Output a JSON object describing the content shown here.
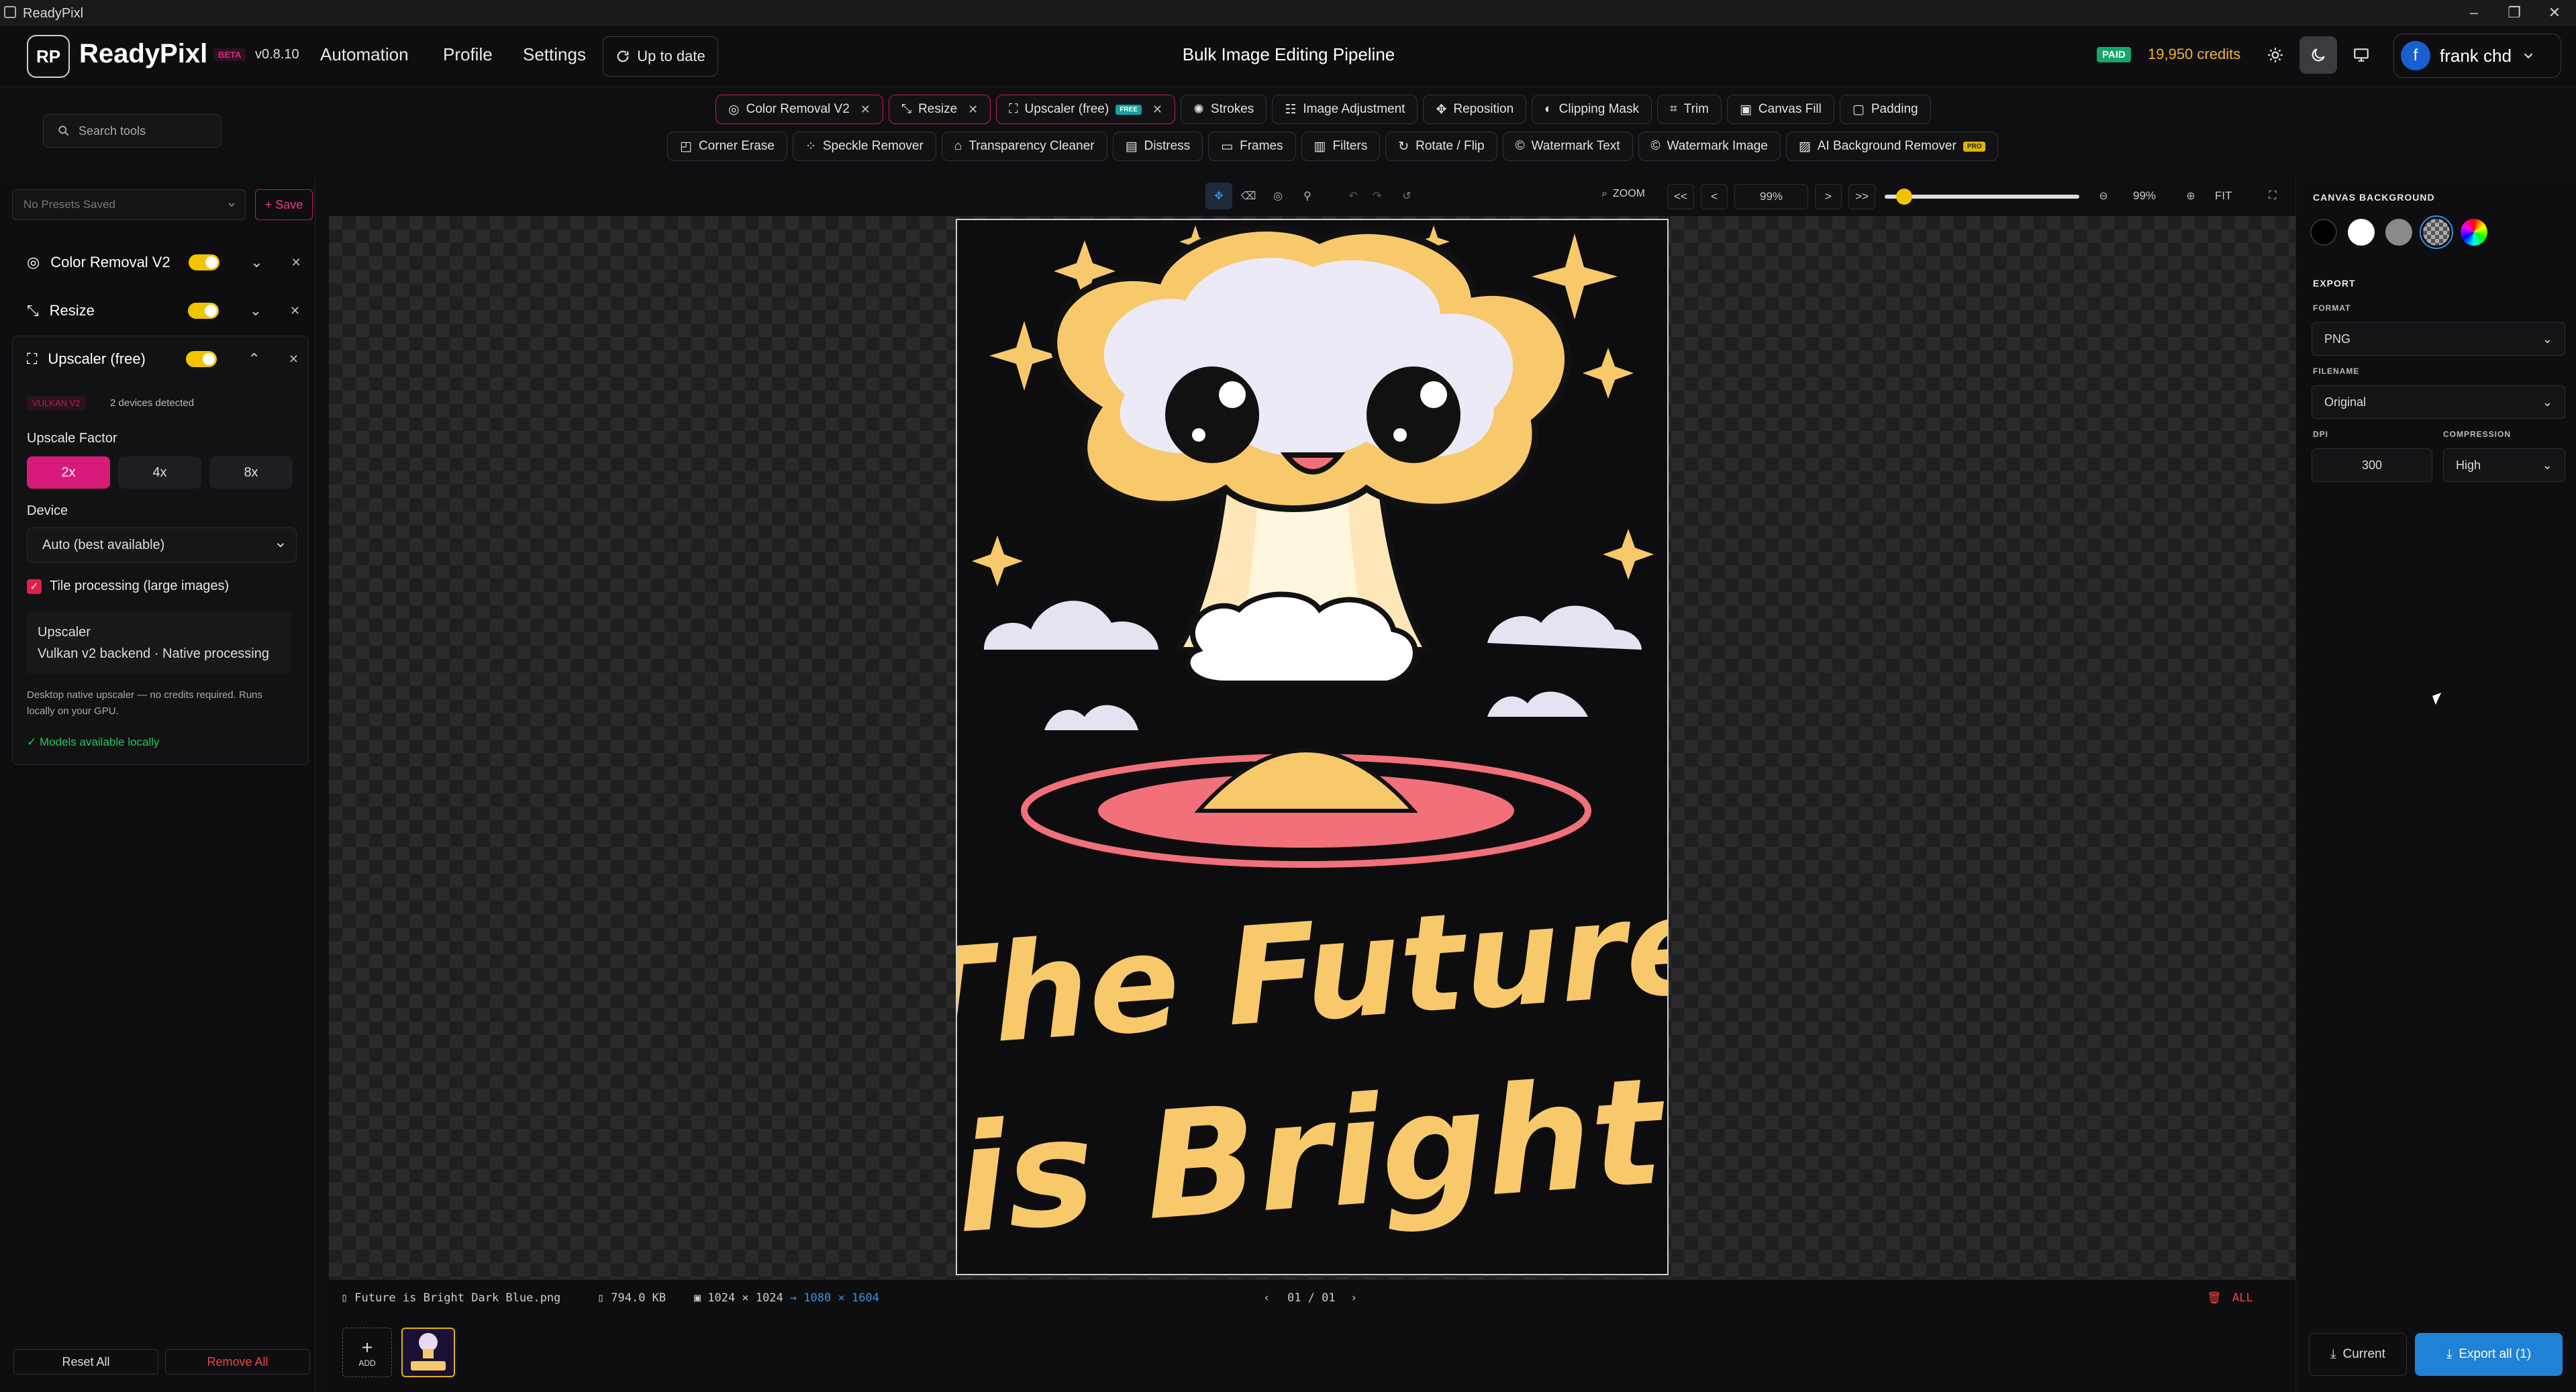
{
  "titlebar": {
    "app_name": "ReadyPixl"
  },
  "header": {
    "logo_text": "RP",
    "brand": "ReadyPixl",
    "beta": "BETA",
    "version": "v0.8.10",
    "nav": [
      "Automation",
      "Profile",
      "Settings"
    ],
    "up_to_date": "Up to date",
    "page_title": "Bulk Image Editing Pipeline",
    "plan_badge": "PAID",
    "credits": "19,950 credits",
    "user_initial": "f",
    "user_name": "frank chd"
  },
  "search": {
    "placeholder": "Search tools"
  },
  "tools_row1": [
    {
      "label": "Color Removal V2",
      "active": true
    },
    {
      "label": "Resize",
      "active": true
    },
    {
      "label": "Upscaler (free)",
      "active": true,
      "badge": "FREE"
    },
    {
      "label": "Strokes"
    },
    {
      "label": "Image Adjustment"
    },
    {
      "label": "Reposition"
    },
    {
      "label": "Clipping Mask"
    },
    {
      "label": "Trim"
    },
    {
      "label": "Canvas Fill"
    },
    {
      "label": "Padding"
    }
  ],
  "tools_row2": [
    {
      "label": "Corner Erase"
    },
    {
      "label": "Speckle Remover"
    },
    {
      "label": "Transparency Cleaner"
    },
    {
      "label": "Distress"
    },
    {
      "label": "Frames"
    },
    {
      "label": "Filters"
    },
    {
      "label": "Rotate / Flip"
    },
    {
      "label": "Watermark Text"
    },
    {
      "label": "Watermark Image"
    },
    {
      "label": "AI Background Remover",
      "badge": "PRO"
    }
  ],
  "presets": {
    "selected": "No Presets Saved",
    "save_label": "+ Save"
  },
  "pipeline": [
    {
      "name": "Color Removal V2",
      "enabled": true
    },
    {
      "name": "Resize",
      "enabled": true
    },
    {
      "name": "Upscaler (free)",
      "enabled": true
    }
  ],
  "upscaler": {
    "backend_badge": "VULKAN V2",
    "devices": "2 devices detected",
    "factor_label": "Upscale Factor",
    "factors": [
      "2x",
      "4x",
      "8x"
    ],
    "selected_factor": "2x",
    "device_label": "Device",
    "device_value": "Auto (best available)",
    "tile_label": "Tile processing (large images)",
    "tile_checked": true,
    "info_title": "Upscaler",
    "info_sub": "Vulkan v2 backend · Native processing",
    "note": "Desktop native upscaler — no credits required. Runs locally on your GPU.",
    "models": "✓ Models available locally"
  },
  "left_footer": {
    "reset": "Reset All",
    "remove": "Remove All"
  },
  "zoom": {
    "label": "ZOOM",
    "value": "99%",
    "percent": "99%",
    "fit": "FIT",
    "level": 0.1
  },
  "canvas_background": {
    "label": "CANVAS BACKGROUND",
    "swatches": [
      "#000000",
      "#ffffff",
      "#8a8a8a",
      "checker",
      "rainbow"
    ]
  },
  "export": {
    "label": "EXPORT",
    "format_label": "FORMAT",
    "format": "PNG",
    "filename_label": "FILENAME",
    "filename": "Original",
    "dpi_label": "DPI",
    "dpi": "300",
    "compression_label": "COMPRESSION",
    "compression": "High",
    "current": "Current",
    "export_all": "Export all (1)"
  },
  "file": {
    "name": "Future is Bright Dark Blue.png",
    "size": "794.0 KB",
    "dims": "1024 × 1024",
    "out_dims": "→ 1080 × 1604",
    "page": "01 / 01",
    "add": "ADD",
    "all": "ALL"
  },
  "artwork": {
    "line1": "The Future",
    "line2": "is Bright"
  },
  "colors": {
    "accent": "#d81b78",
    "toggle": "#f2c400",
    "primary": "#1f82d6",
    "credits": "#f2b234",
    "paid": "#17a56b"
  }
}
